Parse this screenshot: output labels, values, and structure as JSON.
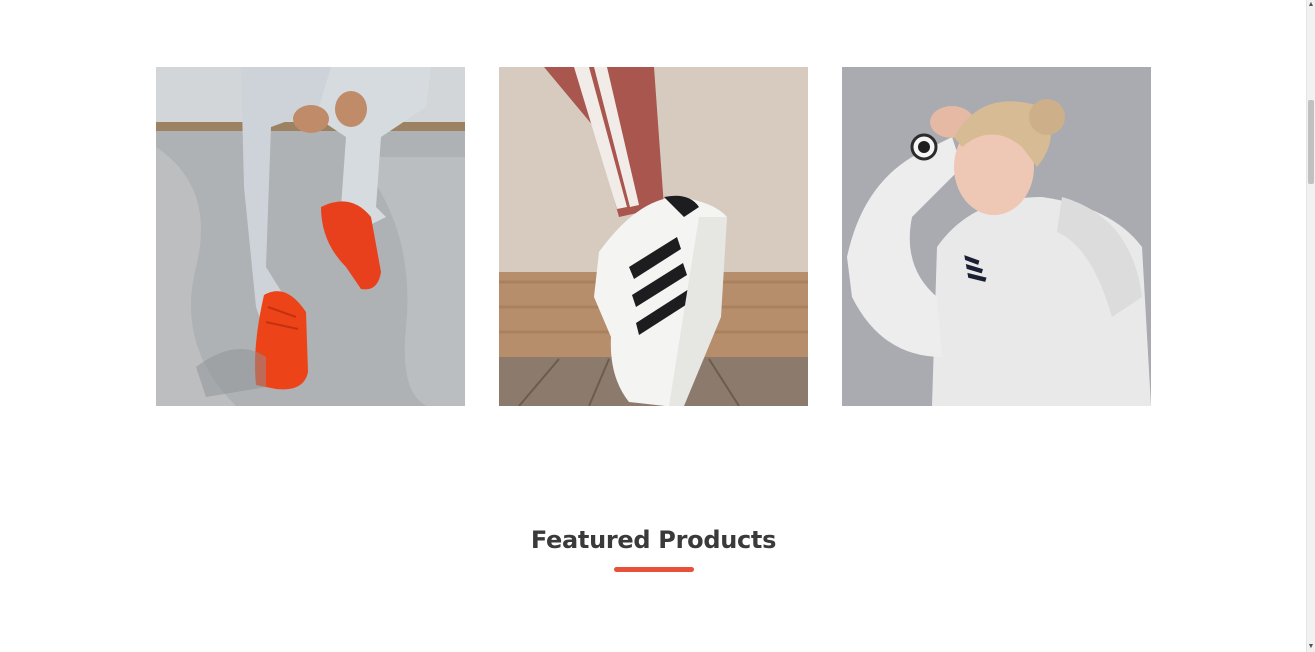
{
  "gallery": {
    "tiles": [
      {
        "alt": "orange-sneakers-photo"
      },
      {
        "alt": "white-striped-sneaker-photo"
      },
      {
        "alt": "woman-white-hoodie-photo"
      }
    ]
  },
  "featured": {
    "title": "Featured Products"
  },
  "colors": {
    "accent": "#e8503a",
    "title_text": "#3a3a3a"
  }
}
